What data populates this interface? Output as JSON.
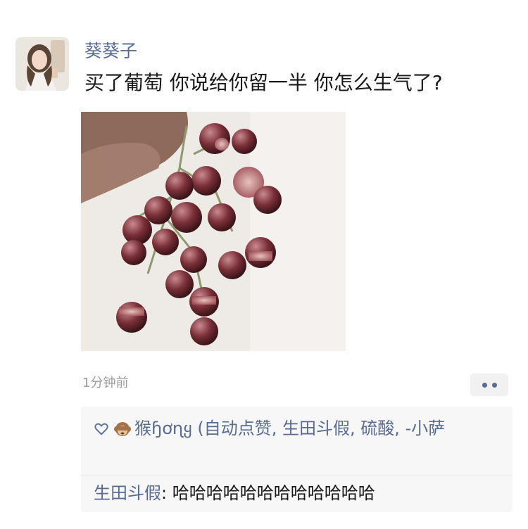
{
  "post": {
    "username": "葵葵子",
    "text": "买了葡萄 你说给你留一半 你怎么生气了?",
    "timestamp": "1分钟前",
    "photo_icon": "grapes-photo"
  },
  "likes": {
    "icon": "heart-icon",
    "text": "猴ɧơɳყ (自动点赞, 生田斗假, 硫酸, -小萨"
  },
  "comments": [
    {
      "author": "生田斗假",
      "separator": ": ",
      "text": "哈哈哈哈哈哈哈哈哈哈哈哈"
    }
  ],
  "colors": {
    "link": "#576b95",
    "text": "#191919",
    "muted": "#9b9b9b",
    "comment_bg": "#f7f7f7"
  }
}
